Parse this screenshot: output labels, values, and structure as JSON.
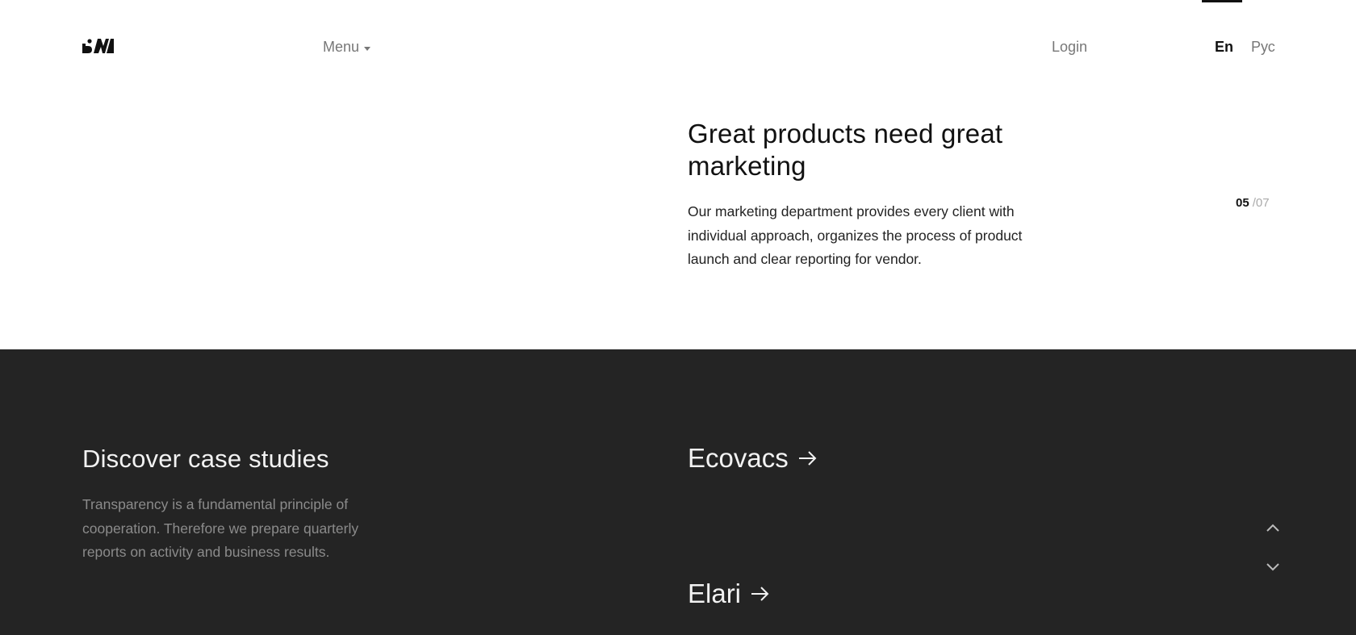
{
  "header": {
    "logo_icon": "bm-logo-icon",
    "menu_label": "Menu",
    "menu_icon": "caret-down-icon",
    "login_label": "Login",
    "languages": [
      "En",
      "Рус"
    ],
    "active_language": "En"
  },
  "hero": {
    "title": "Great products need great marketing",
    "description": "Our marketing department provides every client with individual approach, organizes the process of product launch and clear reporting for vendor.",
    "counter_current": "05",
    "counter_total": "/07"
  },
  "cases": {
    "title": "Discover case studies",
    "description": "Transparency is a fundamental principle of cooperation.  Therefore we prepare quarterly reports on activity and business results.",
    "items": [
      {
        "label": "Ecovacs",
        "icon": "arrow-right-icon"
      },
      {
        "label": "Elari",
        "icon": "arrow-right-icon"
      }
    ],
    "nav_up_icon": "chevron-up-icon",
    "nav_down_icon": "chevron-down-icon"
  },
  "colors": {
    "dark_background": "#242424",
    "text_dark": "#111111",
    "text_muted": "#777777"
  }
}
